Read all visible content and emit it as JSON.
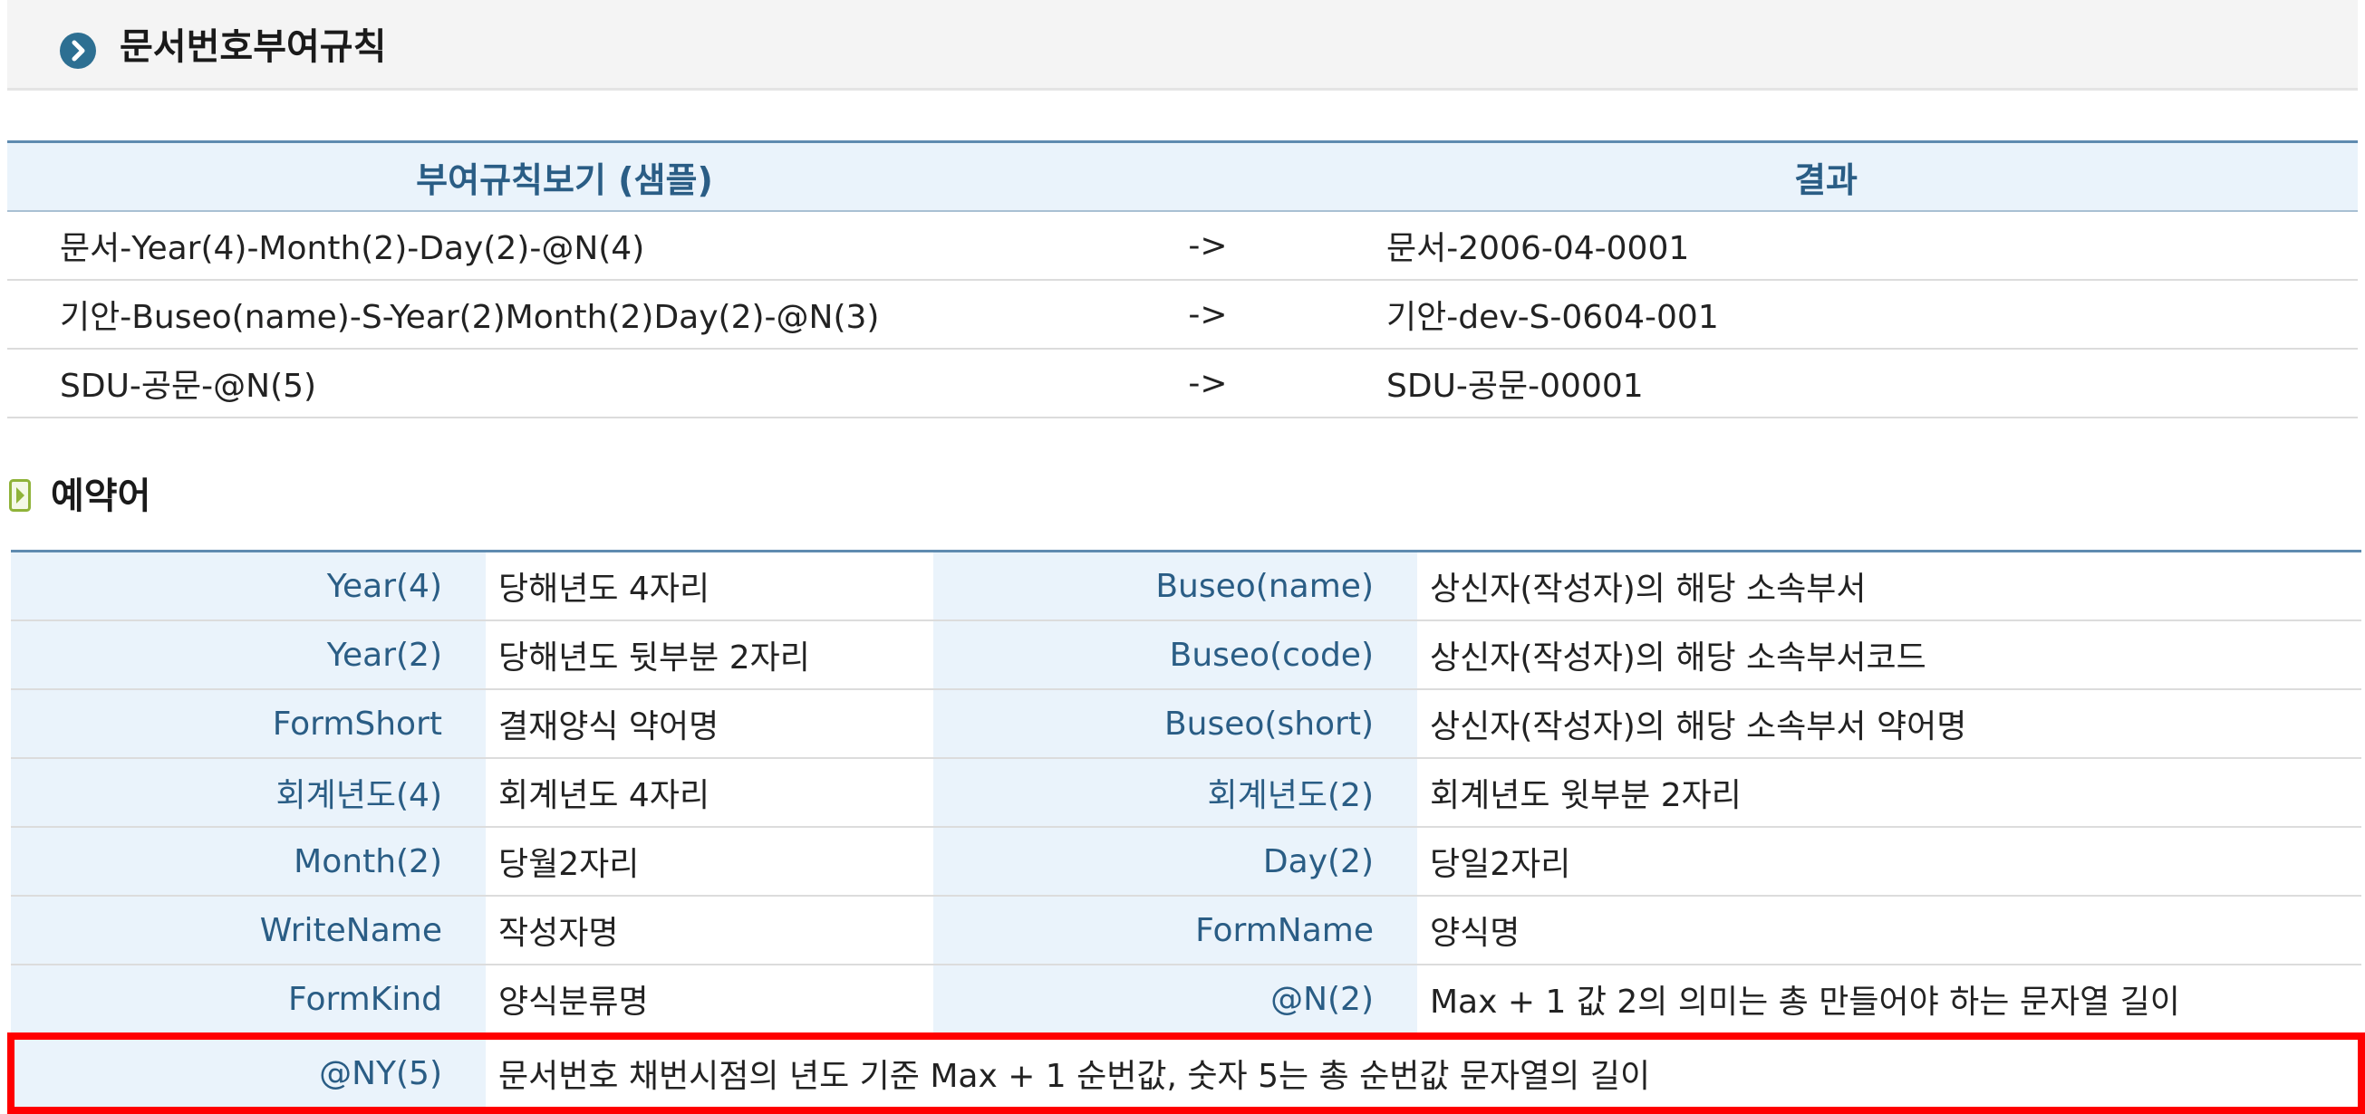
{
  "section_title": "문서번호부여규칙",
  "rules_table": {
    "headers": [
      "부여규칙보기 (샘플)",
      "결과"
    ],
    "rows": [
      {
        "rule": "문서-Year(4)-Month(2)-Day(2)-@N(4)",
        "arrow": "->",
        "result": "문서-2006-04-0001"
      },
      {
        "rule": "기안-Buseo(name)-S-Year(2)Month(2)Day(2)-@N(3)",
        "arrow": "->",
        "result": "기안-dev-S-0604-001"
      },
      {
        "rule": "SDU-공문-@N(5)",
        "arrow": "->",
        "result": "SDU-공문-00001"
      }
    ]
  },
  "reserved_title": "예약어",
  "keywords": [
    {
      "k1": "Year(4)",
      "d1": "당해년도 4자리",
      "k2": "Buseo(name)",
      "d2": "상신자(작성자)의 해당 소속부서"
    },
    {
      "k1": "Year(2)",
      "d1": "당해년도 뒷부분 2자리",
      "k2": "Buseo(code)",
      "d2": "상신자(작성자)의 해당 소속부서코드"
    },
    {
      "k1": "FormShort",
      "d1": "결재양식 약어명",
      "k2": "Buseo(short)",
      "d2": "상신자(작성자)의 해당 소속부서 약어명"
    },
    {
      "k1": "회계년도(4)",
      "d1": "회계년도 4자리",
      "k2": "회계년도(2)",
      "d2": "회계년도 윗부분 2자리"
    },
    {
      "k1": "Month(2)",
      "d1": "당월2자리",
      "k2": "Day(2)",
      "d2": "당일2자리"
    },
    {
      "k1": "WriteName",
      "d1": "작성자명",
      "k2": "FormName",
      "d2": "양식명"
    },
    {
      "k1": "FormKind",
      "d1": "양식분류명",
      "k2": "@N(2)",
      "d2": "Max + 1 값 2의 의미는 총 만들어야 하는 문자열 길이"
    }
  ],
  "highlighted_keyword": {
    "key": "@NY(5)",
    "desc": "문서번호 채번시점의 년도 기준 Max + 1 순번값, 숫자 5는 총 순번값 문자열의 길이"
  },
  "colors": {
    "header_text": "#2a5d85",
    "header_bg": "#eaf3fb",
    "table_top_border": "#5f8bb0",
    "title_icon": "#2d6f92",
    "reserved_icon": "#8fb339",
    "highlight_border": "#ff0000"
  },
  "icons": {
    "title": "chevron-circle-right-icon",
    "reserved": "play-square-icon"
  }
}
